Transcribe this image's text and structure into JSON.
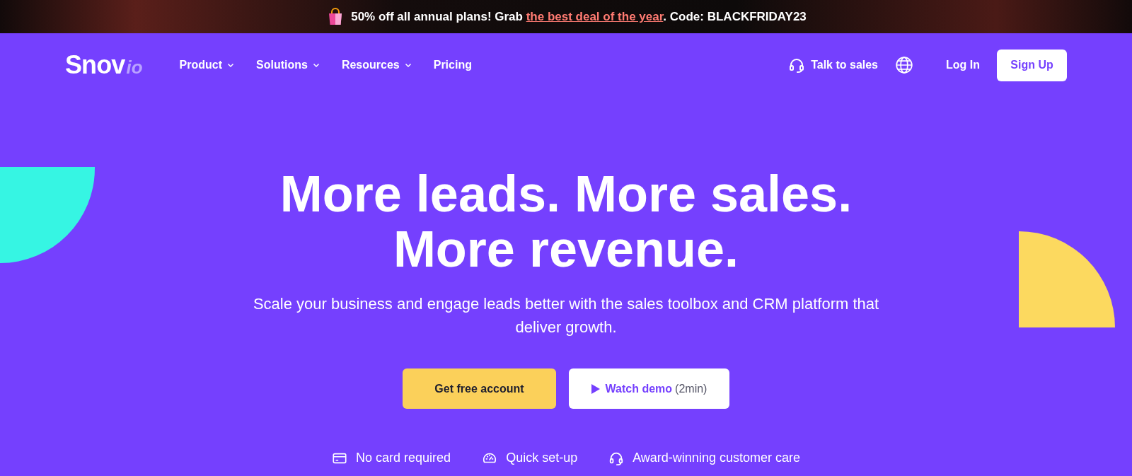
{
  "promo_banner": {
    "text_before": "50% off all annual plans! Grab ",
    "link": "the best deal of the year",
    "text_after": ". Code: BLACKFRIDAY23"
  },
  "header": {
    "logo": {
      "main": "Snov",
      "suffix": "io"
    },
    "nav": [
      {
        "label": "Product",
        "dropdown": true
      },
      {
        "label": "Solutions",
        "dropdown": true
      },
      {
        "label": "Resources",
        "dropdown": true
      },
      {
        "label": "Pricing",
        "dropdown": false
      }
    ],
    "talk_to_sales": "Talk to sales",
    "log_in": "Log In",
    "sign_up": "Sign Up"
  },
  "hero": {
    "title_lines": [
      "More leads. More sales.",
      "More revenue."
    ],
    "subtitle": "Scale your business and engage leads better with the sales toolbox and CRM platform that deliver growth.",
    "primary_button": "Get free account",
    "secondary_button": {
      "label": "Watch demo",
      "note": "(2min)"
    },
    "features": [
      {
        "kind": "card",
        "label": "No card required"
      },
      {
        "kind": "gauge",
        "label": "Quick set-up"
      },
      {
        "kind": "headset",
        "label": "Award-winning customer care"
      }
    ]
  }
}
